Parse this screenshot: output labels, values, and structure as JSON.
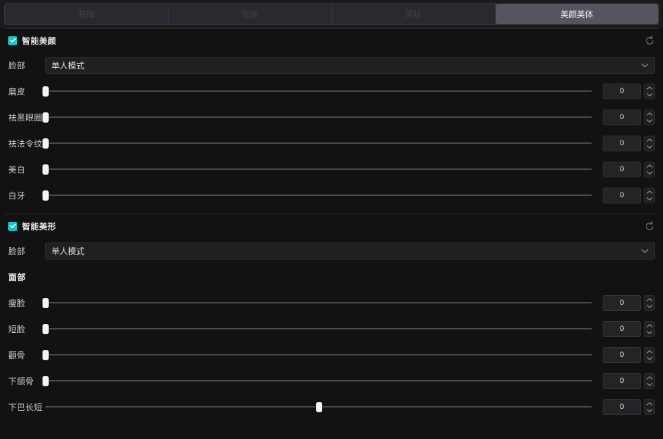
{
  "tabs": [
    {
      "label": "基础",
      "active": false
    },
    {
      "label": "抠像",
      "active": false
    },
    {
      "label": "蒙版",
      "active": false
    },
    {
      "label": "美颜美体",
      "active": true
    }
  ],
  "colors": {
    "accent": "#18c7c9",
    "panel_bg": "#121212",
    "tab_active_bg": "#56545e",
    "knob": "#f4f4f4",
    "track": "#4a4a4c"
  },
  "sections": [
    {
      "title": "智能美颜",
      "enabled": true,
      "reset_icon": "reset-icon",
      "face_label": "脸部",
      "face_mode": "单人模式",
      "sliders": [
        {
          "label": "磨皮",
          "value": "0",
          "percent": 0,
          "bipolar": false
        },
        {
          "label": "祛黑眼圈",
          "value": "0",
          "percent": 0,
          "bipolar": false
        },
        {
          "label": "祛法令纹",
          "value": "0",
          "percent": 0,
          "bipolar": false
        },
        {
          "label": "美白",
          "value": "0",
          "percent": 0,
          "bipolar": false
        },
        {
          "label": "白牙",
          "value": "0",
          "percent": 0,
          "bipolar": false
        }
      ]
    },
    {
      "title": "智能美形",
      "enabled": true,
      "reset_icon": "reset-icon",
      "face_label": "脸部",
      "face_mode": "单人模式",
      "subhead": "面部",
      "sliders": [
        {
          "label": "瘦脸",
          "value": "0",
          "percent": 0,
          "bipolar": false
        },
        {
          "label": "短脸",
          "value": "0",
          "percent": 0,
          "bipolar": false
        },
        {
          "label": "颧骨",
          "value": "0",
          "percent": 0,
          "bipolar": false
        },
        {
          "label": "下颌骨",
          "value": "0",
          "percent": 0,
          "bipolar": false
        },
        {
          "label": "下巴长短",
          "value": "0",
          "percent": 50,
          "bipolar": true
        }
      ]
    }
  ]
}
